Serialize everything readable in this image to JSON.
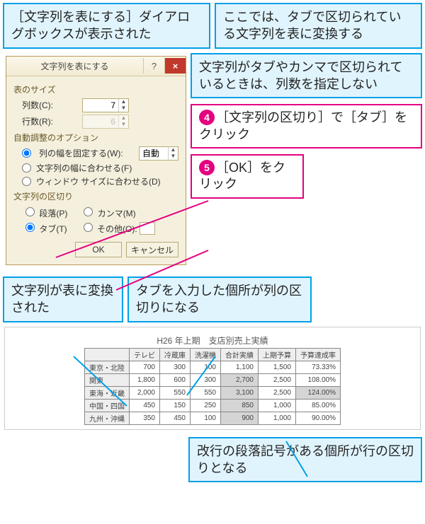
{
  "callouts": {
    "shown": "［文字列を表にする］ダイアログボックスが表示された",
    "convertTabbed": "ここでは、タブで区切られている文字列を表に変換する",
    "noColCount": "文字列がタブやカンマで区切られているときは、列数を指定しない",
    "step4": "［文字列の区切り］で［タブ］をクリック",
    "step5": "［OK］をクリック",
    "converted": "文字列が表に変換された",
    "tabIsCol": "タブを入力した個所が列の区切りになる",
    "paraIsRow": "改行の段落記号がある個所が行の区切りとなる"
  },
  "steps": {
    "n4": "4",
    "n5": "5"
  },
  "dialog": {
    "title": "文字列を表にする",
    "help": "?",
    "close": "×",
    "sectionSize": "表のサイズ",
    "cols_label": "列数(C):",
    "cols_value": "7",
    "rows_label": "行数(R):",
    "rows_value": "6",
    "sectionAuto": "自動調整のオプション",
    "opt_fix": "列の幅を固定する(W):",
    "fix_value": "自動",
    "opt_text": "文字列の幅に合わせる(F)",
    "opt_window": "ウィンドウ サイズに合わせる(D)",
    "sectionSep": "文字列の区切り",
    "sep_para": "段落(P)",
    "sep_comma": "カンマ(M)",
    "sep_tab": "タブ(T)",
    "sep_other": "その他(O):",
    "ok": "OK",
    "cancel": "キャンセル"
  },
  "result": {
    "title": "H26 年上期　支店別売上実績",
    "headers": [
      "",
      "テレビ",
      "冷蔵庫",
      "洗濯機",
      "合計実績",
      "上期予算",
      "予算達成率"
    ],
    "rows": [
      {
        "name": "東京・北陸",
        "cells": [
          "700",
          "300",
          "100",
          "1,100",
          "1,500",
          "73.33%"
        ]
      },
      {
        "name": "関東",
        "cells": [
          "1,800",
          "600",
          "300",
          "2,700",
          "2,500",
          "108.00%"
        ],
        "hi": [
          3
        ]
      },
      {
        "name": "東海・近畿",
        "cells": [
          "2,000",
          "550",
          "550",
          "3,100",
          "2,500",
          "124.00%"
        ],
        "hi": [
          3,
          5
        ]
      },
      {
        "name": "中国・四国",
        "cells": [
          "450",
          "150",
          "250",
          "850",
          "1,000",
          "85.00%"
        ],
        "hi": [
          3
        ]
      },
      {
        "name": "九州・沖縄",
        "cells": [
          "350",
          "450",
          "100",
          "900",
          "1,000",
          "90.00%"
        ],
        "hi": [
          3
        ]
      }
    ]
  }
}
